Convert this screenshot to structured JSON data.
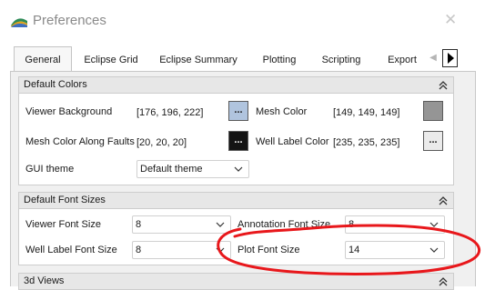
{
  "window": {
    "title": "Preferences",
    "close_glyph": "✕",
    "icon": "resinsight-app-icon"
  },
  "tabs": [
    {
      "label": "General",
      "active": true
    },
    {
      "label": "Eclipse Grid"
    },
    {
      "label": "Eclipse Summary"
    },
    {
      "label": "Plotting"
    },
    {
      "label": "Scripting"
    },
    {
      "label": "Export"
    }
  ],
  "tab_scroll": {
    "left_glyph": "◀",
    "right_icon": "triangle-right-icon"
  },
  "default_colors": {
    "title": "Default Colors",
    "viewer_background": {
      "label": "Viewer Background",
      "value": "[176, 196, 222]",
      "color": "#b0c4de",
      "button_text": "..."
    },
    "mesh_color": {
      "label": "Mesh Color",
      "value": "[149, 149, 149]",
      "color": "#959595"
    },
    "mesh_color_faults": {
      "label": "Mesh Color Along Faults",
      "value": "[20, 20, 20]",
      "color": "#141414",
      "button_text": "..."
    },
    "well_label_color": {
      "label": "Well Label Color",
      "value": "[235, 235, 235]",
      "color": "#ebebeb",
      "button_text": "..."
    },
    "gui_theme": {
      "label": "GUI theme",
      "value": "Default theme"
    }
  },
  "default_font_sizes": {
    "title": "Default Font Sizes",
    "viewer_font_size": {
      "label": "Viewer Font Size",
      "value": "8"
    },
    "annotation_font_size": {
      "label": "Annotation Font Size",
      "value": "8"
    },
    "well_label_font_size": {
      "label": "Well Label Font Size",
      "value": "8"
    },
    "plot_font_size": {
      "label": "Plot Font Size",
      "value": "14"
    }
  },
  "views_3d": {
    "title": "3d Views"
  },
  "colors": {
    "annotation": "#e8171b",
    "swatch_border": "#5a5a5a"
  }
}
